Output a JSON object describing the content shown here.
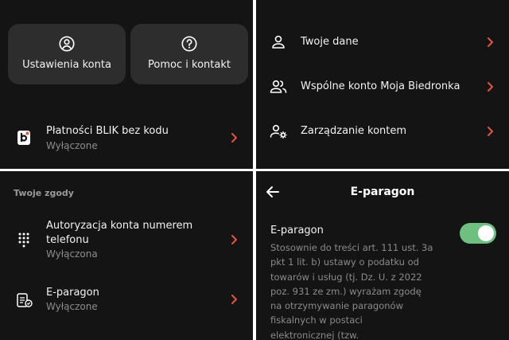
{
  "panel1": {
    "card_account": "Ustawienia konta",
    "card_help": "Pomoc i kontakt",
    "blik_title": "Płatności BLIK bez kodu",
    "blik_status": "Wyłączone"
  },
  "panel2": {
    "items": [
      {
        "label": "Twoje dane"
      },
      {
        "label": "Wspólne konto Moja Biedronka"
      },
      {
        "label": "Zarządzanie kontem"
      }
    ]
  },
  "panel3": {
    "section_title": "Twoje zgody",
    "phone_auth_line1": "Autoryzacja konta numerem",
    "phone_auth_line2": "telefonu",
    "phone_auth_status": "Wyłączona",
    "eparagon_title": "E-paragon",
    "eparagon_status": "Wyłączone"
  },
  "panel4": {
    "header_title": "E-paragon",
    "setting_title": "E-paragon",
    "toggle_on": true,
    "description_lines": [
      "Stosownie do treści art. 111 ust. 3a",
      "pkt 1 lit. b) ustawy o podatku od",
      "towarów i usług (tj. Dz. U. z 2022",
      "poz. 931 ze zm.) wyrażam zgodę",
      "na otrzymywanie paragonów",
      "fiskalnych w postaci",
      "elektronicznej (tzw."
    ]
  },
  "colors": {
    "background": "#141414",
    "card": "#2d2d2d",
    "accent_chevron": "#e8533f",
    "toggle": "#6dc07f"
  }
}
